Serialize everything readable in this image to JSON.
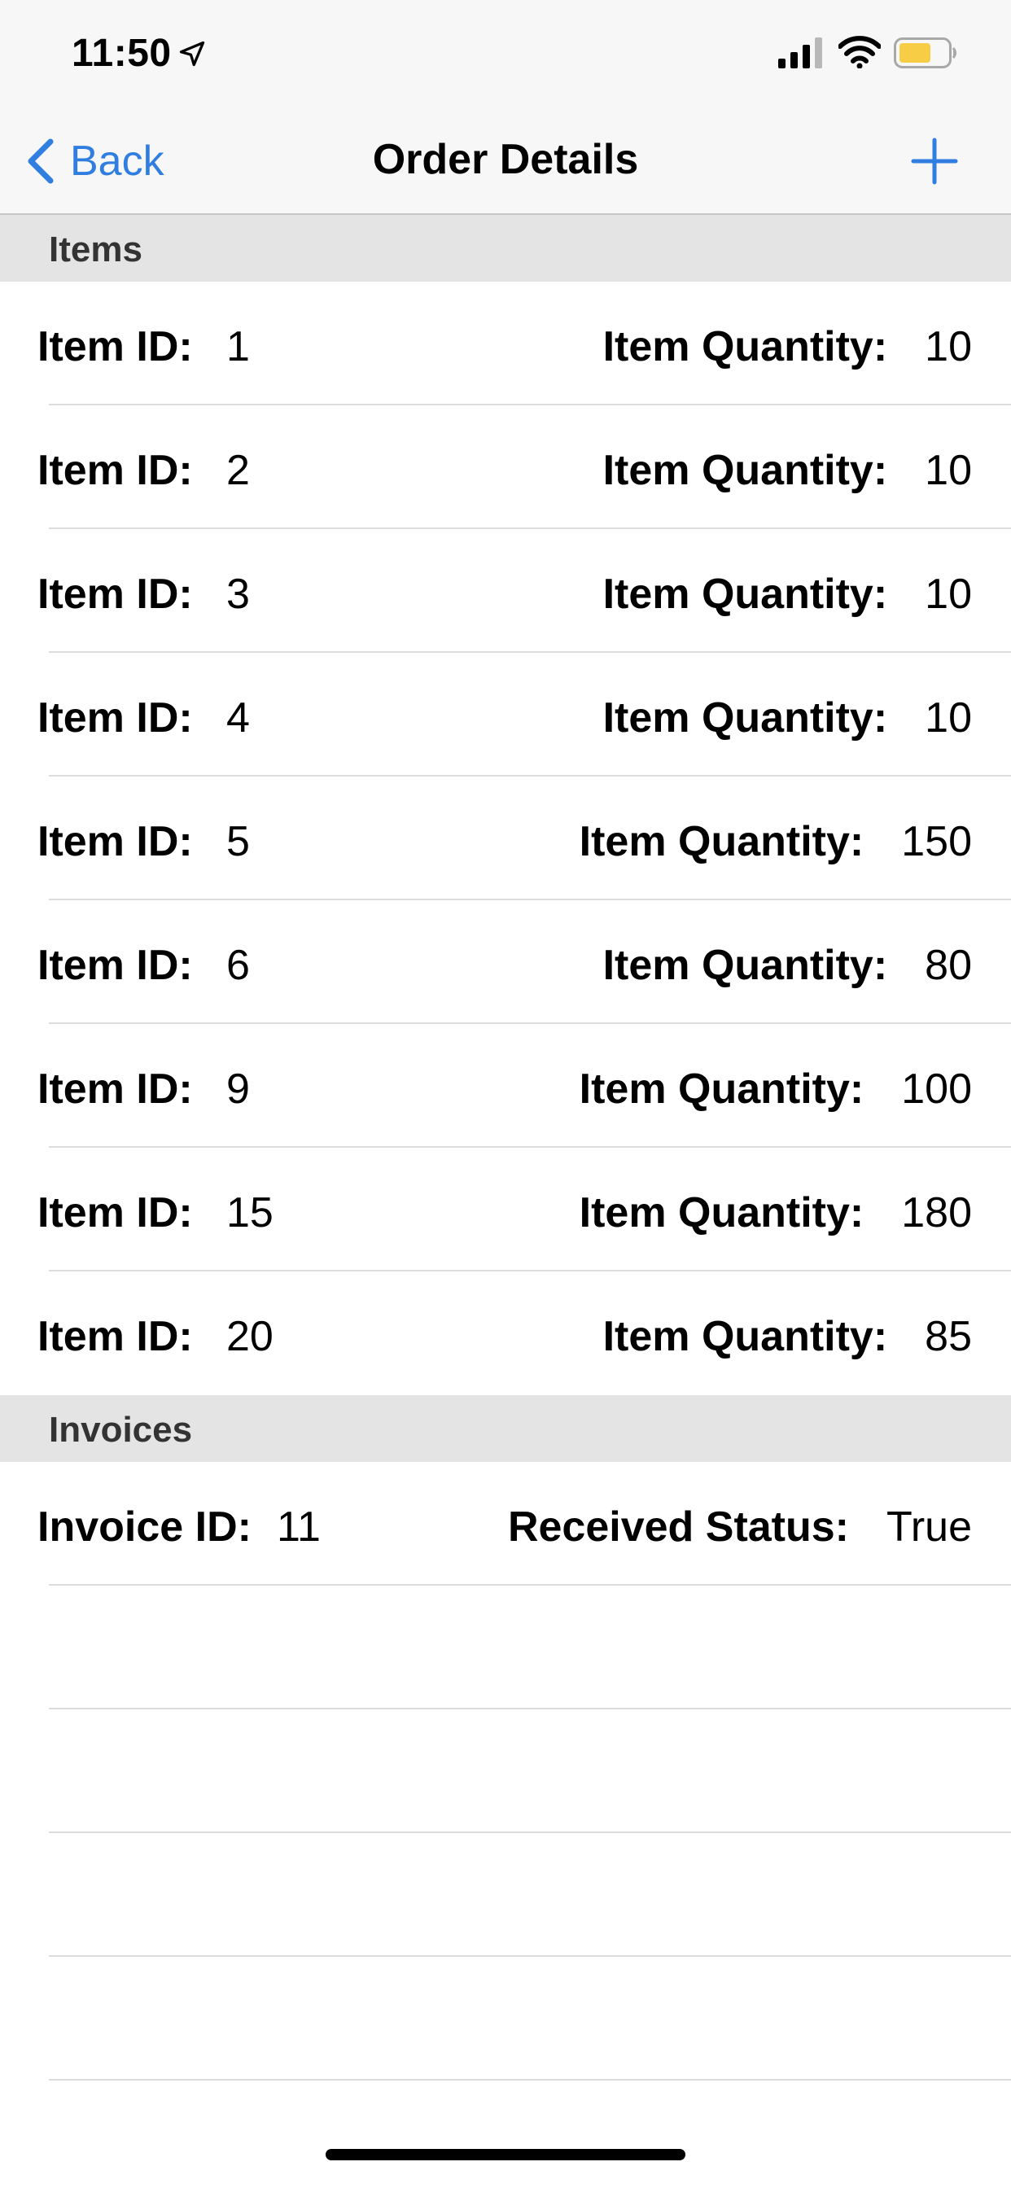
{
  "status_bar": {
    "time": "11:50",
    "icons": [
      "location-arrow-icon",
      "signal-bars-icon",
      "wifi-icon",
      "battery-icon"
    ],
    "battery_color": "#f7cd46"
  },
  "nav": {
    "back_label": "Back",
    "title": "Order Details",
    "add_icon": "plus-icon",
    "accent_color": "#2f7ee0"
  },
  "sections": {
    "items_header": "Items",
    "invoices_header": "Invoices"
  },
  "labels": {
    "item_id": "Item ID:",
    "item_quantity": "Item Quantity:",
    "invoice_id": "Invoice ID:",
    "received_status": "Received Status:"
  },
  "items": [
    {
      "id": "1",
      "quantity": "10"
    },
    {
      "id": "2",
      "quantity": "10"
    },
    {
      "id": "3",
      "quantity": "10"
    },
    {
      "id": "4",
      "quantity": "10"
    },
    {
      "id": "5",
      "quantity": "150"
    },
    {
      "id": "6",
      "quantity": "80"
    },
    {
      "id": "9",
      "quantity": "100"
    },
    {
      "id": "15",
      "quantity": "180"
    },
    {
      "id": "20",
      "quantity": "85"
    }
  ],
  "invoices": [
    {
      "id": "11",
      "received_status": "True"
    }
  ]
}
